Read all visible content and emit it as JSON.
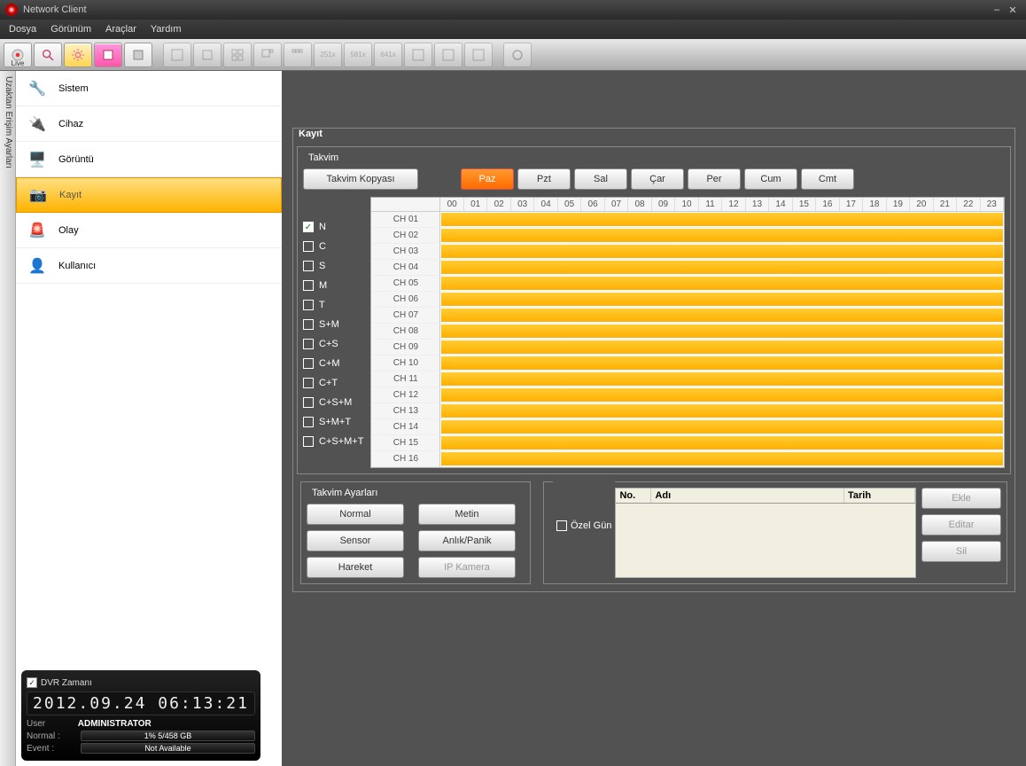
{
  "window": {
    "title": "Network Client"
  },
  "menu": {
    "file": "Dosya",
    "view": "Görünüm",
    "tools": "Araçlar",
    "help": "Yardım"
  },
  "toolbar": {
    "live": "Live",
    "res1": "251x",
    "res2": "581x",
    "res3": "641x"
  },
  "vtab": "Uzaktan Erişim Ayarları",
  "sidebar": {
    "items": [
      {
        "label": "Sistem"
      },
      {
        "label": "Cihaz"
      },
      {
        "label": "Görüntü"
      },
      {
        "label": "Kayıt"
      },
      {
        "label": "Olay"
      },
      {
        "label": "Kullanıcı"
      }
    ]
  },
  "status": {
    "dvr_time_label": "DVR Zamanı",
    "clock": "2012.09.24 06:13:21",
    "user_label": "User",
    "user": "ADMINISTRATOR",
    "normal_label": "Normal :",
    "normal_value": "1% 5/458 GB",
    "event_label": "Event   :",
    "event_value": "Not Available"
  },
  "panel": {
    "title": "Kayıt",
    "calendar": {
      "title": "Takvim",
      "copy_btn": "Takvim Kopyası",
      "days": [
        "Paz",
        "Pzt",
        "Sal",
        "Çar",
        "Per",
        "Cum",
        "Cmt"
      ],
      "modes": [
        "N",
        "C",
        "S",
        "M",
        "T",
        "S+M",
        "C+S",
        "C+M",
        "C+T",
        "C+S+M",
        "S+M+T",
        "C+S+M+T"
      ],
      "hours": [
        "00",
        "01",
        "02",
        "03",
        "04",
        "05",
        "06",
        "07",
        "08",
        "09",
        "10",
        "11",
        "12",
        "13",
        "14",
        "15",
        "16",
        "17",
        "18",
        "19",
        "20",
        "21",
        "22",
        "23"
      ],
      "channels": [
        "CH 01",
        "CH 02",
        "CH 03",
        "CH 04",
        "CH 05",
        "CH 06",
        "CH 07",
        "CH 08",
        "CH 09",
        "CH 10",
        "CH 11",
        "CH 12",
        "CH 13",
        "CH 14",
        "CH 15",
        "CH 16"
      ]
    },
    "settings": {
      "title": "Takvim Ayarları",
      "btn_normal": "Normal",
      "btn_metin": "Metin",
      "btn_sensor": "Sensor",
      "btn_anlik": "Anlık/Panik",
      "btn_hareket": "Hareket",
      "btn_ipkamera": "IP Kamera"
    },
    "special": {
      "title": "Özel Gün",
      "col_no": "No.",
      "col_adi": "Adı",
      "col_tarih": "Tarih",
      "btn_ekle": "Ekle",
      "btn_editar": "Editar",
      "btn_sil": "Sil"
    }
  }
}
